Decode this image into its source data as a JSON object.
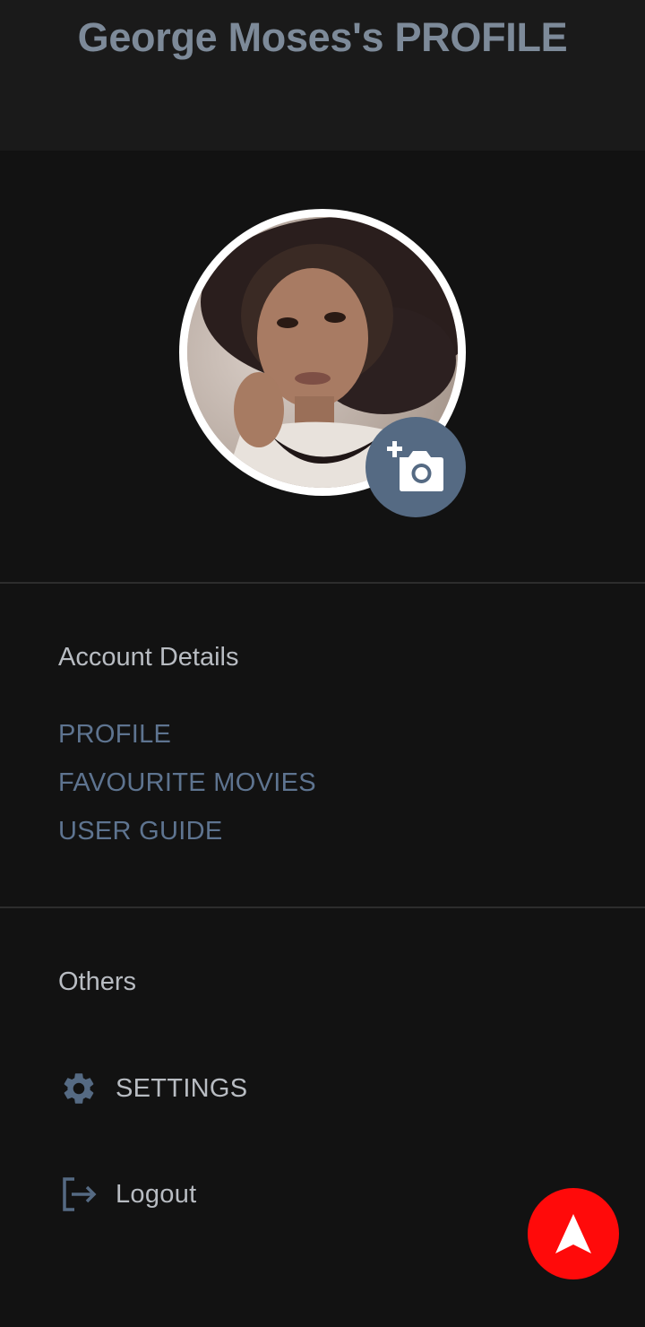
{
  "header": {
    "title": "George Moses's PROFILE"
  },
  "profile": {
    "avatar_icon": "profile-photo",
    "change_photo_icon": "add-a-photo-icon"
  },
  "account": {
    "heading": "Account Details",
    "links": [
      {
        "label": "PROFILE"
      },
      {
        "label": "FAVOURITE MOVIES"
      },
      {
        "label": "USER GUIDE"
      }
    ]
  },
  "others": {
    "heading": "Others",
    "settings": {
      "label": "SETTINGS",
      "icon": "gear-icon"
    },
    "logout": {
      "label": "Logout",
      "icon": "logout-icon"
    }
  },
  "fab": {
    "icon": "navigation-arrow-icon"
  },
  "colors": {
    "background": "#121212",
    "header_background": "#1a1a1a",
    "accent": "#556a83",
    "link": "#5e7490",
    "text": "#b8bcc2",
    "fab": "#ff0a0a"
  }
}
